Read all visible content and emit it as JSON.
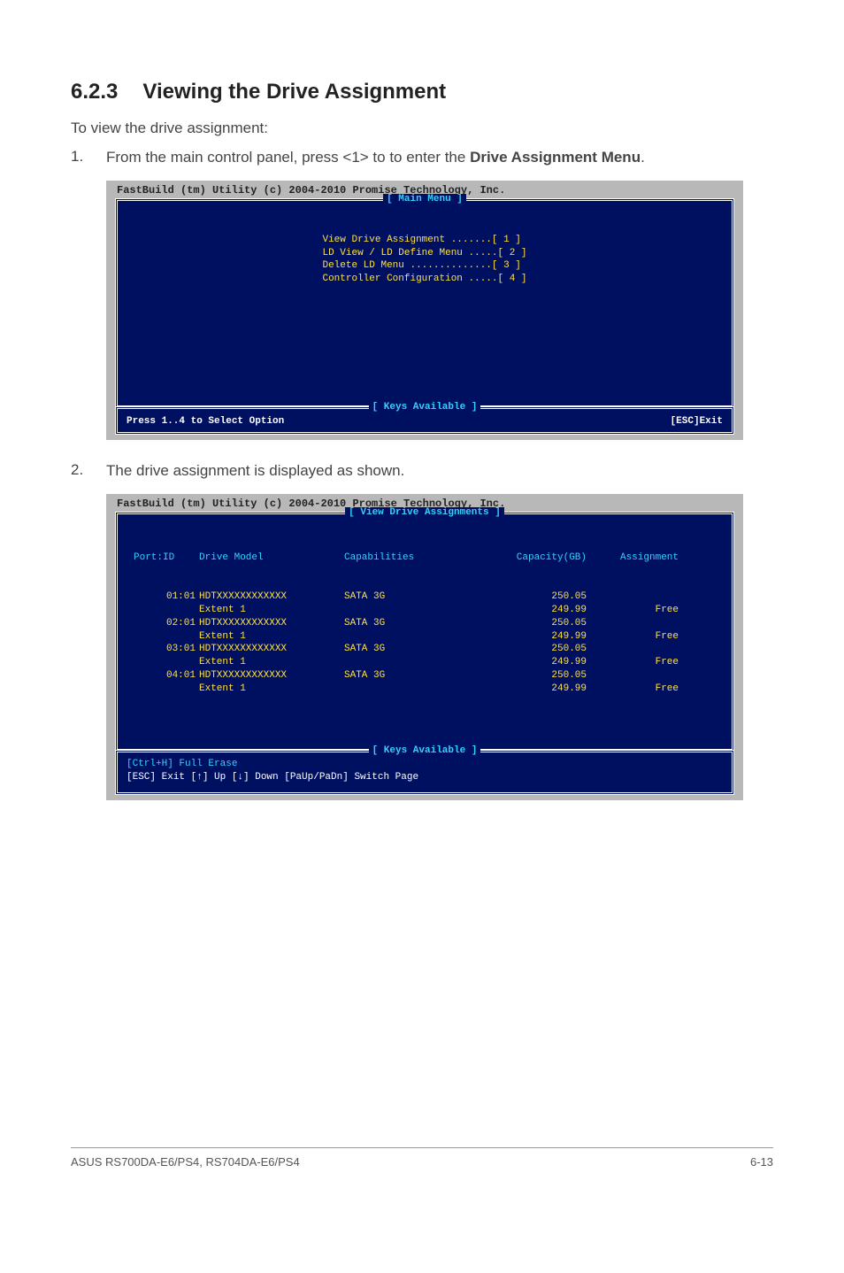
{
  "section": {
    "number": "6.2.3",
    "title": "Viewing the Drive Assignment"
  },
  "intro": "To view the drive assignment:",
  "steps": {
    "s1": {
      "num": "1.",
      "pre": "From the main control panel, press <1> to to enter the ",
      "bold": "Drive Assignment Menu",
      "post": "."
    },
    "s2": {
      "num": "2.",
      "text": "The drive assignment is displayed as shown."
    }
  },
  "console1": {
    "header": "FastBuild (tm) Utility (c) 2004-2010 Promise Technology, Inc.",
    "main_label": "[ Main Menu ]",
    "menu": {
      "l1": "View Drive Assignment .......[ 1 ]",
      "l2": "LD View / LD Define Menu .....[ 2 ]",
      "l3": "Delete LD Menu ..............[ 3 ]",
      "l4": "Controller Configuration .....[ 4 ]"
    },
    "keys_label": "[ Keys Available ]",
    "press": "Press 1..4 to Select Option",
    "esc": "[ESC]Exit"
  },
  "console2": {
    "header": "FastBuild (tm) Utility (c) 2004-2010 Promise Technology, Inc.",
    "view_label": "[ View Drive Assignments ]",
    "headers": {
      "port": "Port:ID",
      "model": "Drive Model",
      "cap": "Capabilities",
      "capgb": "Capacity(GB)",
      "assign": "Assignment"
    },
    "chart_data": {
      "type": "table",
      "columns": [
        "Port:ID",
        "Drive Model",
        "Capabilities",
        "Capacity(GB)",
        "Assignment"
      ],
      "rows": [
        {
          "port": "01:01",
          "model": "HDTXXXXXXXXXXXX",
          "cap": "SATA 3G",
          "capgb": "250.05",
          "extent_label": "Extent 1",
          "extent_cap": "249.99",
          "assign": "Free"
        },
        {
          "port": "02:01",
          "model": "HDTXXXXXXXXXXXX",
          "cap": "SATA 3G",
          "capgb": "250.05",
          "extent_label": "Extent 1",
          "extent_cap": "249.99",
          "assign": "Free"
        },
        {
          "port": "03:01",
          "model": "HDTXXXXXXXXXXXX",
          "cap": "SATA 3G",
          "capgb": "250.05",
          "extent_label": "Extent 1",
          "extent_cap": "249.99",
          "assign": "Free"
        },
        {
          "port": "04:01",
          "model": "HDTXXXXXXXXXXXX",
          "cap": "SATA 3G",
          "capgb": "250.05",
          "extent_label": "Extent 1",
          "extent_cap": "249.99",
          "assign": "Free"
        }
      ]
    },
    "keys_label": "[ Keys Available ]",
    "keys_line1": "[Ctrl+H] Full Erase",
    "keys_line2": "[ESC] Exit  [↑] Up  [↓] Down  [PaUp/PaDn] Switch Page"
  },
  "footer": {
    "left": "ASUS RS700DA-E6/PS4, RS704DA-E6/PS4",
    "right": "6-13"
  }
}
